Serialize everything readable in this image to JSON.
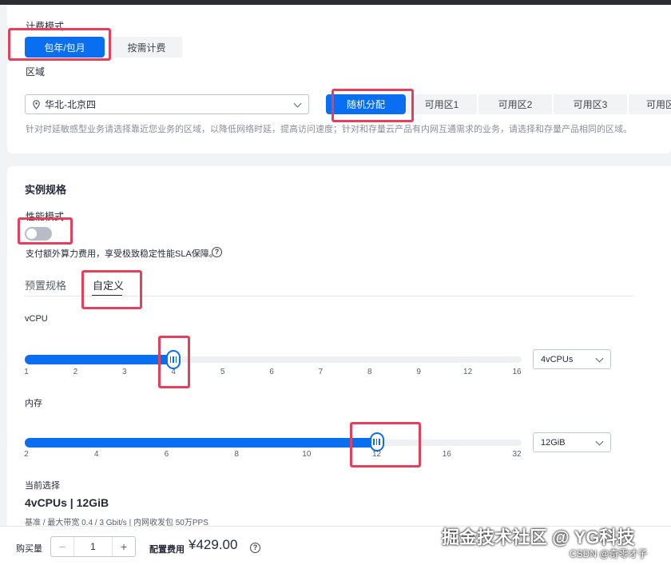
{
  "billing": {
    "label": "计费模式",
    "options": [
      "包年/包月",
      "按需计费"
    ]
  },
  "region": {
    "label": "区域",
    "selected": "华北-北京四",
    "zones": [
      "随机分配",
      "可用区1",
      "可用区2",
      "可用区3",
      "可用区"
    ],
    "hint": "针对时延敏感型业务请选择靠近您业务的区域，以降低网络时延，提高访问速度；针对和存量云产品有内网互通需求的业务，请选择和存量产品相同的区域。"
  },
  "spec": {
    "title": "实例规格",
    "perf_label": "性能模式",
    "perf_hint": "支付额外算力费用，享受极致稳定性能SLA保障。",
    "tabs": [
      "预置规格",
      "自定义"
    ],
    "vcpu": {
      "label": "vCPU",
      "ticks": [
        "1",
        "2",
        "3",
        "4",
        "5",
        "6",
        "7",
        "8",
        "9",
        "12",
        "16"
      ],
      "selected_index": 3,
      "select_value": "4vCPUs"
    },
    "memory": {
      "label": "内存",
      "ticks": [
        "2",
        "4",
        "6",
        "8",
        "10",
        "12",
        "16",
        "32"
      ],
      "selected_index": 5,
      "select_value": "12GiB"
    },
    "current_label": "当前选择",
    "current_value": "4vCPUs | 12GiB",
    "current_detail": "基准 / 最大带宽  0.4 / 3 Gbit/s  |  内网收发包  50万PPS"
  },
  "footer": {
    "qty_label": "购买量",
    "qty_value": "1",
    "minus": "−",
    "plus": "+",
    "fee_label": "配置费用",
    "price": "¥429.00"
  },
  "watermark": {
    "main": "掘金技术社区 @ YG科技",
    "sub": "CSDN @奇零才子"
  },
  "icons": {
    "location": "location-pin-icon",
    "help": "question-circle-icon",
    "chevron": "chevron-down-icon"
  },
  "colors": {
    "accent": "#0a6ef0",
    "highlight": "#e5405b"
  }
}
